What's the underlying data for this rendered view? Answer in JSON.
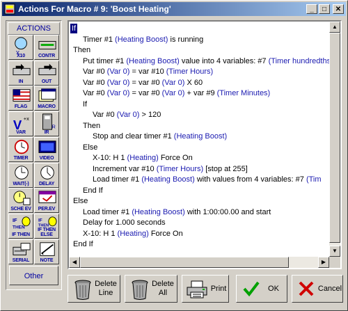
{
  "window": {
    "title": "Actions For Macro # 9: 'Boost Heating'"
  },
  "title_buttons": {
    "minimize": "_",
    "maximize": "□",
    "close": "✕"
  },
  "sidebar": {
    "header": "ACTIONS",
    "tools": [
      {
        "label": "X10"
      },
      {
        "label": "CONTR"
      },
      {
        "label": "IN"
      },
      {
        "label": "OUT"
      },
      {
        "label": "FLAG"
      },
      {
        "label": "MACRO"
      },
      {
        "label": "VAR"
      },
      {
        "label": "IR"
      },
      {
        "label": "TIMER"
      },
      {
        "label": "VIDEO"
      },
      {
        "label": "WAIT(-)"
      },
      {
        "label": "DELAY"
      },
      {
        "label": "SCHE EV"
      },
      {
        "label": "PER.EV"
      },
      {
        "label": "IF THEN"
      },
      {
        "label": "IF THEN ELSE"
      },
      {
        "label": "SERIAL"
      },
      {
        "label": "NOTE"
      }
    ],
    "other": "Other"
  },
  "code_lines": [
    {
      "t": [
        {
          "s": "If"
        }
      ],
      "sel": true
    },
    {
      "indent": 1,
      "t": [
        {
          "s": "Timer #1 "
        },
        {
          "s": "(Heating Boost)",
          "v": 1
        },
        {
          "s": " is running"
        }
      ]
    },
    {
      "indent": 0,
      "t": [
        {
          "s": "Then"
        }
      ]
    },
    {
      "indent": 1,
      "t": [
        {
          "s": "Put timer #1 "
        },
        {
          "s": "(Heating Boost)",
          "v": 1
        },
        {
          "s": " value into 4 variables: #7 "
        },
        {
          "s": "(Timer hundredths",
          "v": 1
        }
      ]
    },
    {
      "indent": 1,
      "t": [
        {
          "s": "Var #0 "
        },
        {
          "s": "(Var 0)",
          "v": 1
        },
        {
          "s": " = var #10 "
        },
        {
          "s": "(Timer Hours)",
          "v": 1
        }
      ]
    },
    {
      "indent": 1,
      "t": [
        {
          "s": "Var #0 "
        },
        {
          "s": "(Var 0)",
          "v": 1
        },
        {
          "s": " = var #0 "
        },
        {
          "s": "(Var 0)",
          "v": 1
        },
        {
          "s": "  X  60"
        }
      ]
    },
    {
      "indent": 1,
      "t": [
        {
          "s": "Var #0 "
        },
        {
          "s": "(Var 0)",
          "v": 1
        },
        {
          "s": " = var #0 "
        },
        {
          "s": "(Var 0)",
          "v": 1
        },
        {
          "s": "  +  var #9 "
        },
        {
          "s": "(Timer Minutes)",
          "v": 1
        }
      ]
    },
    {
      "indent": 1,
      "t": [
        {
          "s": "If"
        }
      ]
    },
    {
      "indent": 2,
      "t": [
        {
          "s": "Var #0 "
        },
        {
          "s": "(Var 0)",
          "v": 1
        },
        {
          "s": "  >  120"
        }
      ]
    },
    {
      "indent": 1,
      "t": [
        {
          "s": "Then"
        }
      ]
    },
    {
      "indent": 2,
      "t": [
        {
          "s": "Stop and clear timer #1 "
        },
        {
          "s": "(Heating Boost)",
          "v": 1
        }
      ]
    },
    {
      "indent": 1,
      "t": [
        {
          "s": "Else"
        }
      ]
    },
    {
      "indent": 2,
      "t": [
        {
          "s": "X-10: H 1 "
        },
        {
          "s": "(Heating)",
          "v": 1
        },
        {
          "s": " Force On"
        }
      ]
    },
    {
      "indent": 2,
      "t": [
        {
          "s": "Increment var #10 "
        },
        {
          "s": "(Timer Hours)",
          "v": 1
        },
        {
          "s": "  [stop at 255]"
        }
      ]
    },
    {
      "indent": 2,
      "t": [
        {
          "s": "Load timer #1 "
        },
        {
          "s": "(Heating Boost)",
          "v": 1
        },
        {
          "s": " with values from 4 variables: #7 "
        },
        {
          "s": "(Tim",
          "v": 1
        }
      ]
    },
    {
      "indent": 1,
      "t": [
        {
          "s": "End If"
        }
      ]
    },
    {
      "indent": 0,
      "t": [
        {
          "s": "Else"
        }
      ]
    },
    {
      "indent": 1,
      "t": [
        {
          "s": "Load timer #1 "
        },
        {
          "s": "(Heating Boost)",
          "v": 1
        },
        {
          "s": " with 1:00:00.00 and start"
        }
      ]
    },
    {
      "indent": 1,
      "t": [
        {
          "s": "Delay for 1.000 seconds"
        }
      ]
    },
    {
      "indent": 1,
      "t": [
        {
          "s": "X-10: H 1 "
        },
        {
          "s": "(Heating)",
          "v": 1
        },
        {
          "s": " Force On"
        }
      ]
    },
    {
      "indent": 0,
      "t": [
        {
          "s": "End If"
        }
      ]
    }
  ],
  "buttons": {
    "delete_line": "Delete Line",
    "delete_all": "Delete All",
    "print": "Print",
    "ok": "OK",
    "cancel": "Cancel"
  },
  "colors": {
    "variable": "#1a1ab0",
    "selection": "#000080",
    "ok_check": "#00a000",
    "cancel_x": "#d00000"
  }
}
